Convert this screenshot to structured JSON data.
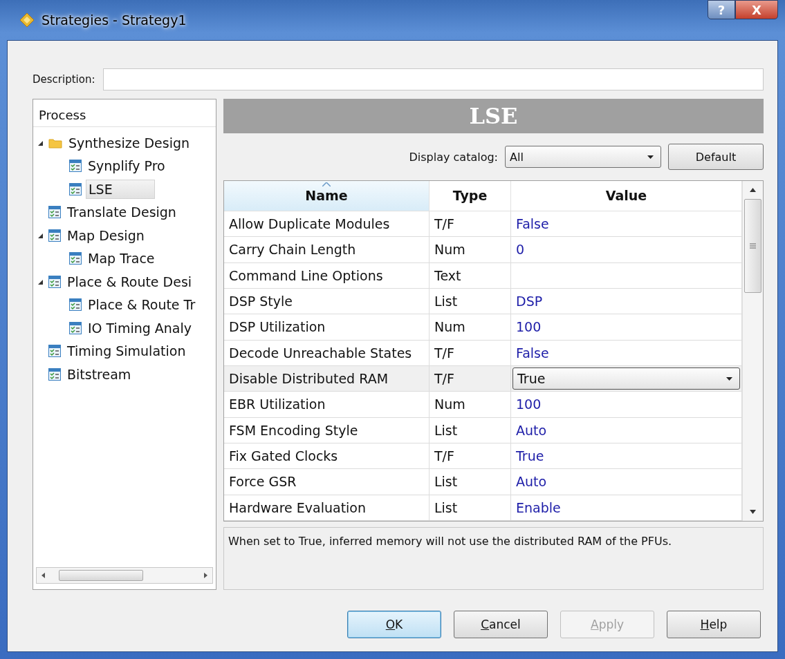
{
  "window": {
    "title": "Strategies - Strategy1",
    "title_buttons": [
      {
        "kind": "help",
        "label": "?"
      },
      {
        "kind": "close",
        "label": "X"
      }
    ]
  },
  "description": {
    "label": "Description:"
  },
  "process_tree": {
    "heading": "Process",
    "items": [
      {
        "label": "Synthesize Design",
        "kind": "folder",
        "expanded": true,
        "selected": false,
        "children": [
          {
            "label": "Synplify Pro",
            "kind": "task",
            "selected": false
          },
          {
            "label": "LSE",
            "kind": "task",
            "selected": true
          }
        ]
      },
      {
        "label": "Translate Design",
        "kind": "task",
        "selected": false
      },
      {
        "label": "Map Design",
        "kind": "task",
        "expanded": true,
        "selected": false,
        "children": [
          {
            "label": "Map Trace",
            "kind": "task",
            "selected": false
          }
        ]
      },
      {
        "label": "Place & Route Desi",
        "kind": "task",
        "expanded": true,
        "selected": false,
        "children": [
          {
            "label": "Place & Route Tr",
            "kind": "task",
            "selected": false
          },
          {
            "label": "IO Timing Analy",
            "kind": "task",
            "selected": false
          }
        ]
      },
      {
        "label": "Timing Simulation",
        "kind": "task",
        "selected": false
      },
      {
        "label": "Bitstream",
        "kind": "task",
        "selected": false
      }
    ]
  },
  "panel": {
    "title": "LSE",
    "catalog_label": "Display catalog:",
    "catalog_value": "All",
    "default_button": "Default"
  },
  "table": {
    "columns": [
      {
        "label": "Name",
        "sorted": true
      },
      {
        "label": "Type",
        "sorted": false
      },
      {
        "label": "Value",
        "sorted": false
      }
    ],
    "rows": [
      {
        "name": "Allow Duplicate Modules",
        "type": "T/F",
        "value": "False",
        "editing": false
      },
      {
        "name": "Carry Chain Length",
        "type": "Num",
        "value": "0",
        "editing": false
      },
      {
        "name": "Command Line Options",
        "type": "Text",
        "editing": false
      },
      {
        "name": "DSP Style",
        "type": "List",
        "value": "DSP",
        "editing": false
      },
      {
        "name": "DSP Utilization",
        "type": "Num",
        "value": "100",
        "editing": false
      },
      {
        "name": "Decode Unreachable States",
        "type": "T/F",
        "value": "False",
        "editing": false
      },
      {
        "name": "Disable Distributed RAM",
        "type": "T/F",
        "value": "True",
        "editing": true
      },
      {
        "name": "EBR Utilization",
        "type": "Num",
        "value": "100",
        "editing": false
      },
      {
        "name": "FSM Encoding Style",
        "type": "List",
        "value": "Auto",
        "editing": false
      },
      {
        "name": "Fix Gated Clocks",
        "type": "T/F",
        "value": "True",
        "editing": false
      },
      {
        "name": "Force GSR",
        "type": "List",
        "value": "Auto",
        "editing": false
      },
      {
        "name": "Hardware Evaluation",
        "type": "List",
        "value": "Enable",
        "editing": false
      }
    ]
  },
  "help_text": "When set to True, inferred memory will not use the distributed RAM of the PFUs.",
  "buttons": [
    {
      "label": "OK",
      "mnemonic": true,
      "default": true,
      "disabled": false
    },
    {
      "label": "Cancel",
      "mnemonic": true,
      "default": false,
      "disabled": false
    },
    {
      "label": "Apply",
      "mnemonic": true,
      "default": false,
      "disabled": true
    },
    {
      "label": "Help",
      "mnemonic": true,
      "default": false,
      "disabled": false
    }
  ]
}
